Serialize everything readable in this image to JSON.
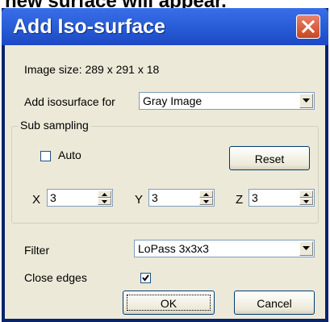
{
  "caption_snippet": "new surface will appear.",
  "window": {
    "title": "Add Iso-surface"
  },
  "image_size": "Image size: 289 x 291 x 18",
  "isosurface": {
    "label": "Add isosurface for",
    "selected": "Gray Image"
  },
  "subsampling": {
    "title": "Sub sampling",
    "auto_label": "Auto",
    "auto_checked": false,
    "reset_label": "Reset",
    "x": {
      "label": "X",
      "value": "3"
    },
    "y": {
      "label": "Y",
      "value": "3"
    },
    "z": {
      "label": "Z",
      "value": "3"
    }
  },
  "filter": {
    "label": "Filter",
    "selected": "LoPass 3x3x3"
  },
  "close_edges": {
    "label": "Close edges",
    "checked": true
  },
  "buttons": {
    "ok": "OK",
    "cancel": "Cancel"
  }
}
